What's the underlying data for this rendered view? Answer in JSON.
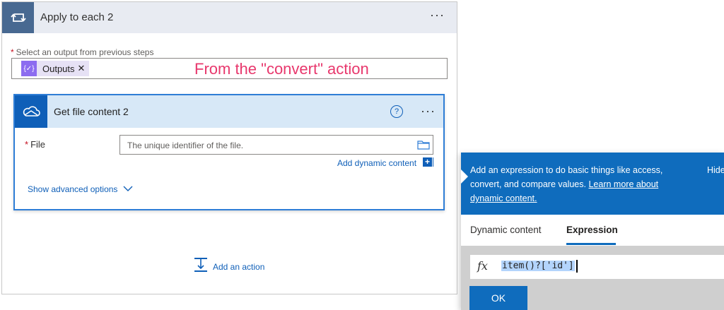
{
  "apply_to_each": {
    "title": "Apply to each 2",
    "more": "···",
    "select_label": "Select an output from previous steps",
    "required_marker": "*",
    "token": {
      "label": "Outputs",
      "icon": "{✓}",
      "remove": "✕"
    },
    "annotation": "From the \"convert\" action"
  },
  "get_file_content": {
    "title": "Get file content 2",
    "help": "?",
    "more": "···",
    "file_label": "File",
    "required_marker": "*",
    "file_placeholder": "The unique identifier of the file.",
    "add_dynamic_content": "Add dynamic content",
    "add_dynamic_plus": "+",
    "show_advanced": "Show advanced options"
  },
  "add_action": "Add an action",
  "panel": {
    "description_prefix": "Add an expression to do basic things like access, convert, and compare values.",
    "learn_more": "Learn more about dynamic content.",
    "hide": "Hide",
    "tabs": [
      "Dynamic content",
      "Expression"
    ],
    "active_tab": "Expression",
    "fx_symbol": "fx",
    "expression": "item()?['id']",
    "ok": "OK"
  },
  "colors": {
    "apply_header_bg": "#e8ebf2",
    "apply_icon_bg": "#486991",
    "card_header_bg": "#d7e8f7",
    "card_border": "#2e7dd6",
    "link_blue": "#0f5fb8",
    "panel_blue": "#0f6cbd",
    "annotation_pink": "#e8386d",
    "token_purple": "#8c6cf0"
  }
}
